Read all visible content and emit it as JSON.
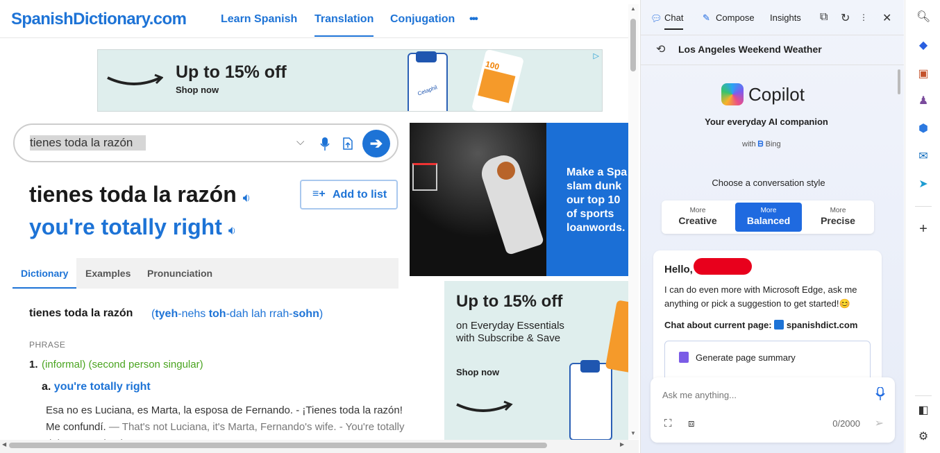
{
  "site": {
    "logo": "SpanishDictionary.com",
    "nav": [
      "Learn Spanish",
      "Translation",
      "Conjugation",
      "•••"
    ]
  },
  "ad_top": {
    "headline": "Up to 15% off",
    "cta": "Shop now",
    "brand_left": "Cetaphil",
    "brand_right": "LA ROCHE-POSAY",
    "sub": "100"
  },
  "search": {
    "value": "tienes toda la razón"
  },
  "result": {
    "spanish": "tienes toda la razón",
    "english": "you're totally right",
    "add_to_list": "Add to list"
  },
  "tabs": [
    "Dictionary",
    "Examples",
    "Pronunciation"
  ],
  "entry": {
    "headword": "tienes toda la razón",
    "pron_open": "(",
    "pron_parts": [
      {
        "t": "tyeh",
        "b": true
      },
      {
        "t": "-nehs ",
        "b": false
      },
      {
        "t": "toh",
        "b": true
      },
      {
        "t": "-dah lah rrah-",
        "b": false
      },
      {
        "t": "sohn",
        "b": true
      }
    ],
    "pron_close": ")",
    "pos": "PHRASE",
    "sense_num": "1.",
    "sense_tags": "(informal) (second person singular)",
    "sub_label": "a.",
    "sub_translation": "you're totally right",
    "example_es": "Esa no es Luciana, es Marta, la esposa de Fernando. - ¡Tienes toda la razón! Me confundí.",
    "dash": "—",
    "example_en": "That's not Luciana, it's Marta, Fernando's wife. - You're totally right! I got mixed up."
  },
  "ad_mid": {
    "text": "Make a Spa\nslam dunk\nour top 10\nof sports\nloanwords."
  },
  "ad_bottom": {
    "headline": "Up to 15% off",
    "sub": "on Everyday Essentials with Subscribe & Save",
    "cta": "Shop now"
  },
  "copilot": {
    "tabs": [
      "Chat",
      "Compose",
      "Insights"
    ],
    "recent": "Los Angeles Weekend Weather",
    "title": "Copilot",
    "subtitle": "Your everyday AI companion",
    "with": "with",
    "bing": "Bing",
    "choose": "Choose a conversation style",
    "styles": [
      {
        "more": "More",
        "name": "Creative"
      },
      {
        "more": "More",
        "name": "Balanced"
      },
      {
        "more": "More",
        "name": "Precise"
      }
    ],
    "hello": "Hello,",
    "intro": "I can do even more with Microsoft Edge, ask me anything or pick a suggestion to get started!😊",
    "chat_about": "Chat about current page:",
    "site": "spanishdict.com",
    "suggestion": "Generate page summary",
    "placeholder": "Ask me anything...",
    "count": "0/2000"
  },
  "colors": {
    "brand": "#1d73d6",
    "copilot_selected": "#1f6ae0",
    "redaction": "#e8001c"
  }
}
